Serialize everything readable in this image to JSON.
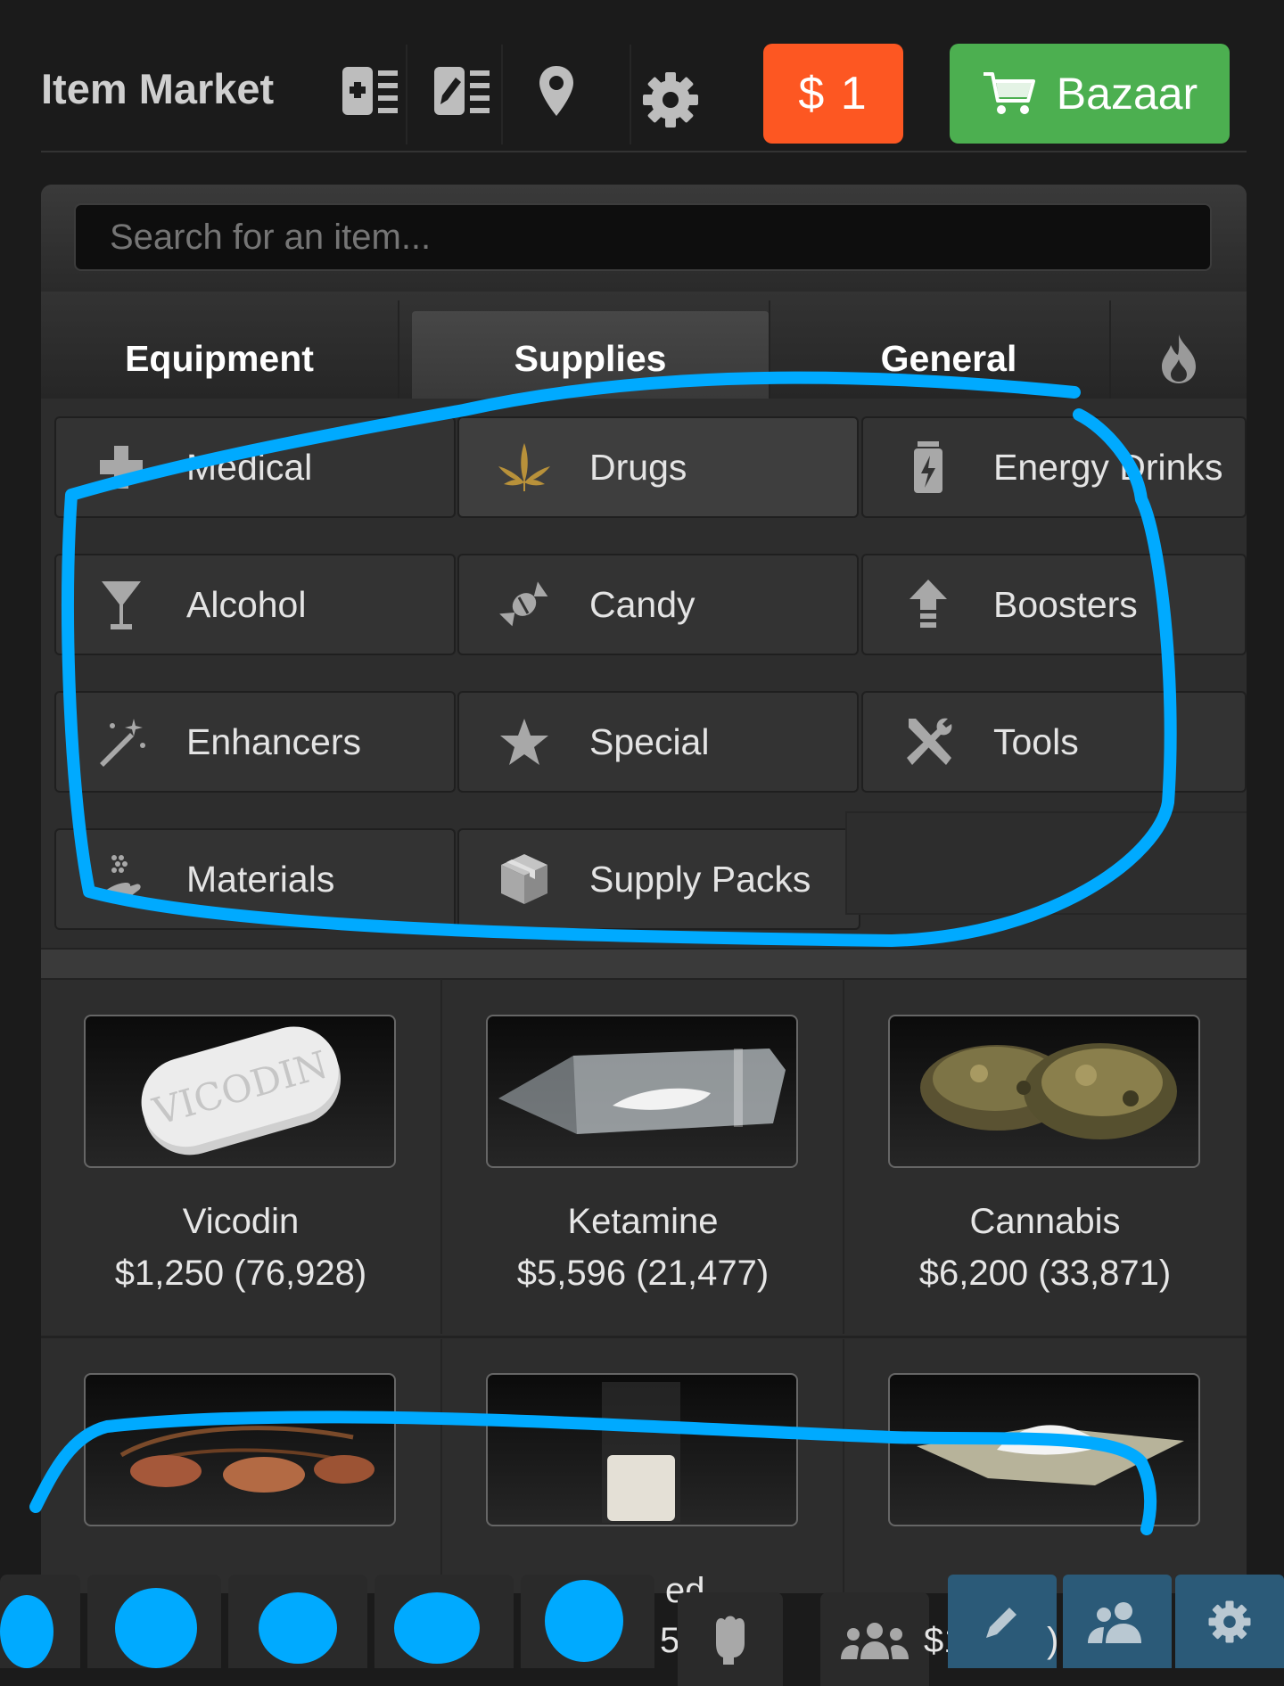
{
  "header": {
    "title": "Item Market",
    "icons": [
      "add-listing-icon",
      "edit-listing-icon",
      "location-pin-icon",
      "gear-icon"
    ],
    "money_button": "$ 1",
    "bazaar_button": "Bazaar",
    "money_color": "#fd5722",
    "bazaar_color": "#4caf50"
  },
  "search": {
    "placeholder": "Search for an item..."
  },
  "tabs": [
    {
      "label": "Equipment",
      "active": false
    },
    {
      "label": "Supplies",
      "active": true
    },
    {
      "label": "General",
      "active": false
    },
    {
      "label": "",
      "icon": "flame-icon"
    }
  ],
  "categories": [
    {
      "label": "Medical",
      "icon": "plus-icon"
    },
    {
      "label": "Drugs",
      "icon": "leaf-icon",
      "active": true
    },
    {
      "label": "Energy Drinks",
      "icon": "energy-can-icon"
    },
    {
      "label": "Alcohol",
      "icon": "cocktail-icon"
    },
    {
      "label": "Candy",
      "icon": "candy-icon"
    },
    {
      "label": "Boosters",
      "icon": "arrow-up-icon"
    },
    {
      "label": "Enhancers",
      "icon": "magic-wand-icon"
    },
    {
      "label": "Special",
      "icon": "star-icon"
    },
    {
      "label": "Tools",
      "icon": "tools-icon"
    },
    {
      "label": "Materials",
      "icon": "materials-icon"
    },
    {
      "label": "Supply Packs",
      "icon": "box-icon"
    }
  ],
  "items": [
    {
      "name": "Vicodin",
      "price": "$1,250 (76,928)",
      "pill_text": "VICODIN"
    },
    {
      "name": "Ketamine",
      "price": "$5,596 (21,477)"
    },
    {
      "name": "Cannabis",
      "price": "$6,200 (33,871)"
    }
  ],
  "bottom_bar": {
    "partial_text_1": "ed",
    "partial_text_2": "5",
    "partial_text_3": "$1",
    "partial_text_4": ")",
    "icons": [
      "fist-icon",
      "group-icon",
      "pencil-icon",
      "users-icon",
      "gear-icon"
    ]
  },
  "annotation_color": "#00aaff"
}
